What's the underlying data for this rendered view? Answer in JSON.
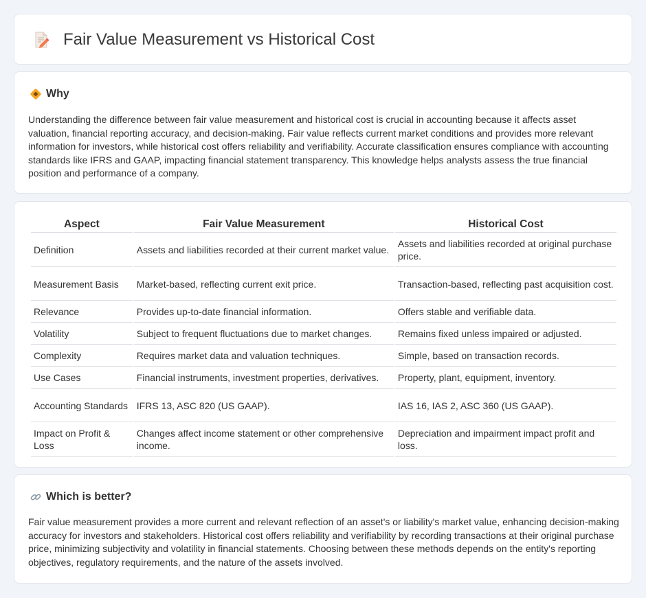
{
  "header": {
    "title": "Fair Value Measurement vs Historical Cost",
    "icon": "document-pencil-icon"
  },
  "why": {
    "heading": "Why",
    "icon": "diamond-sign-icon",
    "text": "Understanding the difference between fair value measurement and historical cost is crucial in accounting because it affects asset valuation, financial reporting accuracy, and decision-making. Fair value reflects current market conditions and provides more relevant information for investors, while historical cost offers reliability and verifiability. Accurate classification ensures compliance with accounting standards like IFRS and GAAP, impacting financial statement transparency. This knowledge helps analysts assess the true financial position and performance of a company."
  },
  "table": {
    "headers": [
      "Aspect",
      "Fair Value Measurement",
      "Historical Cost"
    ],
    "rows": [
      [
        "Definition",
        "Assets and liabilities recorded at their current market value.",
        "Assets and liabilities recorded at original purchase price."
      ],
      [
        "Measurement Basis",
        "Market-based, reflecting current exit price.",
        "Transaction-based, reflecting past acquisition cost."
      ],
      [
        "Relevance",
        "Provides up-to-date financial information.",
        "Offers stable and verifiable data."
      ],
      [
        "Volatility",
        "Subject to frequent fluctuations due to market changes.",
        "Remains fixed unless impaired or adjusted."
      ],
      [
        "Complexity",
        "Requires market data and valuation techniques.",
        "Simple, based on transaction records."
      ],
      [
        "Use Cases",
        "Financial instruments, investment properties, derivatives.",
        "Property, plant, equipment, inventory."
      ],
      [
        "Accounting Standards",
        "IFRS 13, ASC 820 (US GAAP).",
        "IAS 16, IAS 2, ASC 360 (US GAAP)."
      ],
      [
        "Impact on Profit & Loss",
        "Changes affect income statement or other comprehensive income.",
        "Depreciation and impairment impact profit and loss."
      ]
    ]
  },
  "better": {
    "heading": "Which is better?",
    "icon": "link-icon",
    "text": "Fair value measurement provides a more current and relevant reflection of an asset's or liability's market value, enhancing decision-making accuracy for investors and stakeholders. Historical cost offers reliability and verifiability by recording transactions at their original purchase price, minimizing subjectivity and volatility in financial statements. Choosing between these methods depends on the entity's reporting objectives, regulatory requirements, and the nature of the assets involved."
  }
}
